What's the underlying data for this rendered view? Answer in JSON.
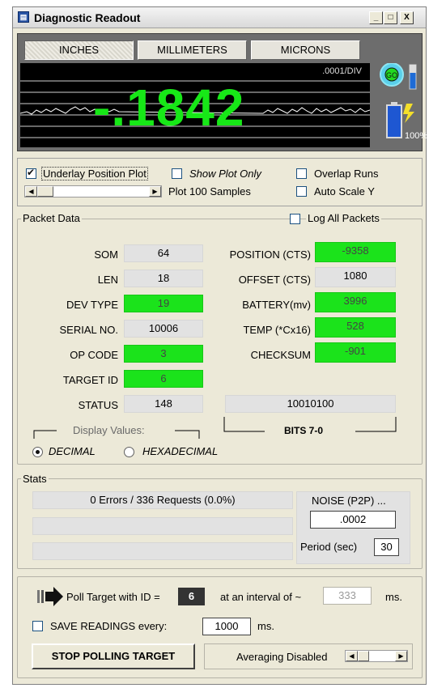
{
  "window": {
    "title": "Diagnostic Readout",
    "minimize": "_",
    "maximize": "□",
    "close": "X"
  },
  "display": {
    "units": [
      "INCHES",
      "MILLIMETERS",
      "MICRONS"
    ],
    "active_unit": "INCHES",
    "scale": ".0001/DIV",
    "readout": "-.1842",
    "battery_percent": "100%",
    "colors": {
      "readout": "#17e817",
      "screen": "#000000"
    }
  },
  "plot_controls": {
    "underlay_label": "Underlay Position  Plot",
    "underlay_checked": true,
    "show_plot_only_label": "Show Plot Only",
    "show_plot_only_checked": false,
    "overlap_runs_label": "Overlap Runs",
    "overlap_runs_checked": false,
    "auto_scale_label": "Auto Scale Y",
    "auto_scale_checked": false,
    "samples_label": "Plot 100 Samples"
  },
  "packet": {
    "title": "Packet Data",
    "log_all_label": "Log All Packets",
    "left_fields": [
      {
        "label": "SOM",
        "value": "64",
        "green": false
      },
      {
        "label": "LEN",
        "value": "18",
        "green": false
      },
      {
        "label": "DEV TYPE",
        "value": "19",
        "green": true
      },
      {
        "label": "SERIAL NO.",
        "value": "10006",
        "green": false
      },
      {
        "label": "OP CODE",
        "value": "3",
        "green": true
      },
      {
        "label": "TARGET ID",
        "value": "6",
        "green": true
      },
      {
        "label": "STATUS",
        "value": "148",
        "green": false
      }
    ],
    "right_fields": [
      {
        "label": "POSITION (CTS)",
        "value": "-9358",
        "green": true
      },
      {
        "label": "OFFSET (CTS)",
        "value": "1080",
        "green": false
      },
      {
        "label": "BATTERY(mv)",
        "value": "3996",
        "green": true
      },
      {
        "label": "TEMP (*Cx16)",
        "value": "528",
        "green": true
      },
      {
        "label": "CHECKSUM",
        "value": "-901",
        "green": true
      }
    ],
    "bits_value": "10010100",
    "bits_label": "BITS 7-0",
    "display_values_label": "Display Values:",
    "decimal_label": "DECIMAL",
    "hex_label": "HEXADECIMAL",
    "selected_format": "DECIMAL"
  },
  "stats": {
    "title": "Stats",
    "summary": "0 Errors / 336 Requests (0.0%)",
    "row2": "",
    "row3": "",
    "noise_label": "NOISE (P2P) ...",
    "noise_value": ".0002",
    "period_label": "Period (sec)",
    "period_value": "30"
  },
  "poll": {
    "poll_label": "Poll Target with ID =",
    "target_id": "6",
    "interval_label": "at an interval of ~",
    "interval_value": "333",
    "interval_unit": "ms.",
    "save_label": "SAVE READINGS every:",
    "save_checked": false,
    "save_value": "1000",
    "save_unit": "ms.",
    "stop_button": "STOP POLLING TARGET",
    "averaging_label": "Averaging Disabled"
  }
}
